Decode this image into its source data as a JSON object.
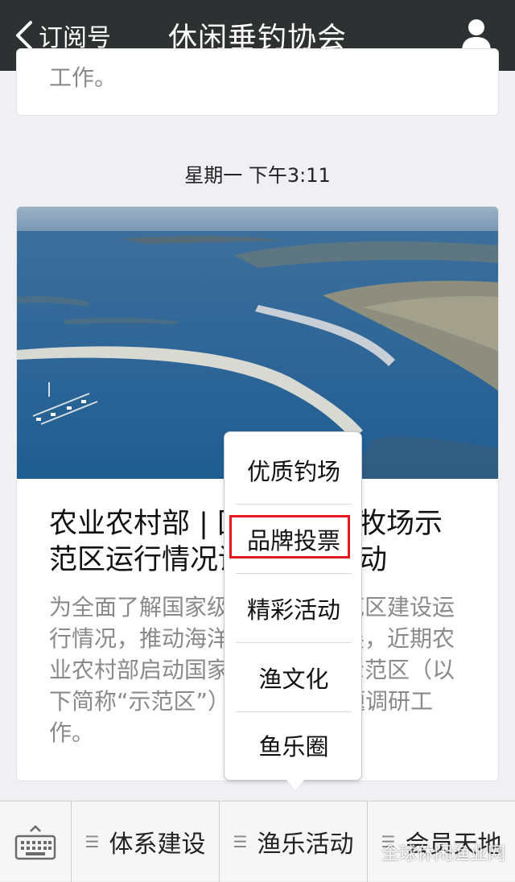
{
  "header": {
    "back_label": "订阅号",
    "title": "休闲垂钓协会",
    "profile_icon": "person-icon"
  },
  "previous_card": {
    "partial_text": "工作。"
  },
  "timestamp": "星期一 下午3:11",
  "article": {
    "title": "农业农村部 | 国家级海洋牧场示范区运行情况调研正式启动",
    "summary": "为全面了解国家级海洋牧场示范区建设运行情况，推动海洋牧场健康发展，近期农业农村部启动国家级海洋牧场示范区（以下简称“示范区”）运行情况专题调研工作。"
  },
  "popup_menu": {
    "items": [
      "优质钓场",
      "品牌投票",
      "精彩活动",
      "渔文化",
      "鱼乐圈"
    ],
    "highlighted_item": "品牌投票",
    "highlight_color": "#e5161c"
  },
  "bottom_menu": {
    "keyboard_icon": "keyboard-icon",
    "tabs": [
      {
        "label": "体系建设"
      },
      {
        "label": "渔乐活动"
      },
      {
        "label": "会员天地"
      }
    ]
  },
  "watermark": "全球休闲渔业网"
}
